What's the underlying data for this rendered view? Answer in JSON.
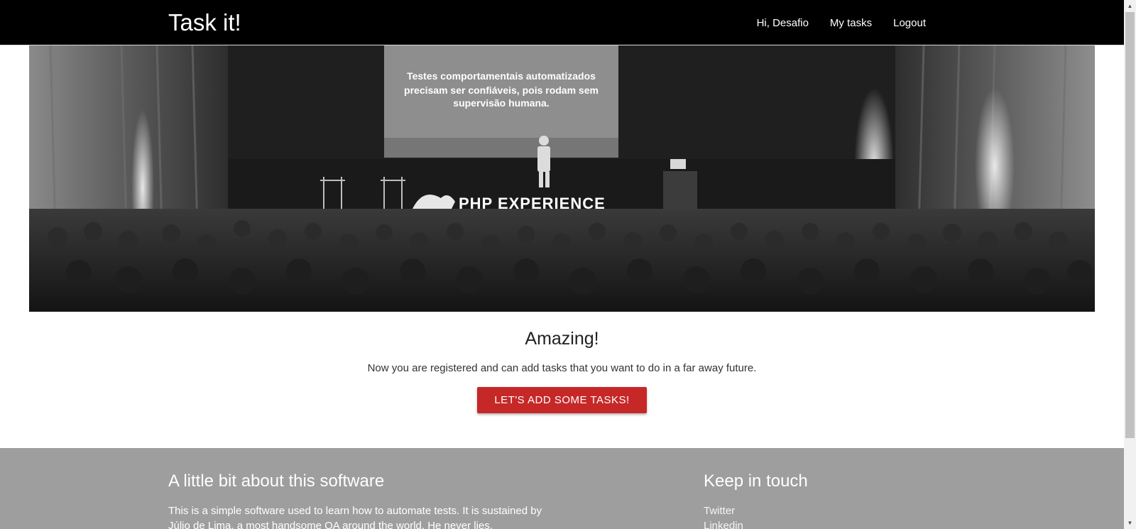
{
  "navbar": {
    "brand": "Task it!",
    "links": [
      {
        "label": "Hi, Desafio"
      },
      {
        "label": "My tasks"
      },
      {
        "label": "Logout"
      }
    ]
  },
  "hero": {
    "slide_lines": [
      "Testes comportamentais automatizados",
      "precisam ser confiáveis, pois rodam sem",
      "supervisão humana."
    ],
    "stage_logo": "PHP EXPERIENCE"
  },
  "content": {
    "headline": "Amazing!",
    "subtext": "Now you are registered and can add tasks that you want to do in a far away future.",
    "cta_label": "LET'S ADD SOME TASKS!"
  },
  "footer": {
    "about_title": "A little bit about this software",
    "about_text": "This is a simple software used to learn how to automate tests. It is sustained by Júlio de Lima, a most handsome QA around the world. He never lies.",
    "contact_title": "Keep in touch",
    "contact_links": [
      {
        "label": "Twitter"
      },
      {
        "label": "Linkedin"
      }
    ]
  },
  "colors": {
    "navbar_bg": "#000000",
    "cta_bg": "#c62828",
    "footer_bg": "#9e9e9e"
  }
}
